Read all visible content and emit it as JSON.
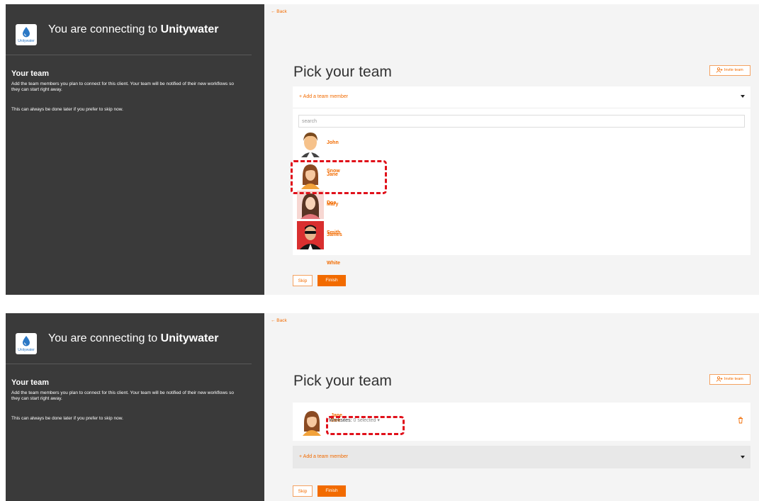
{
  "app": {
    "connecting_prefix": "You are connecting to",
    "client_name": "Unitywater",
    "logo_text": "Unitywater"
  },
  "left_panel": {
    "heading": "Your team",
    "description": "Add the team members you plan to connect for this client. Your team will be notified of their new workflows so they can start right away.",
    "note": "This can always be done later if you prefer to skip now."
  },
  "main": {
    "back_label": "← Back",
    "title": "Pick your team",
    "invite_label": "Invite team",
    "add_member_label": "+ Add a team member",
    "search_placeholder": "search",
    "skip_label": "Skip",
    "finish_label": "Finish"
  },
  "members": [
    {
      "name": "John Snow"
    },
    {
      "name": "Jane Doe"
    },
    {
      "name": "Mary Smith"
    },
    {
      "name": "James White"
    }
  ],
  "selected_member": {
    "name": "Jane Doe",
    "worksites_label": "Worksites:",
    "worksites_value": "0 selected"
  },
  "colors": {
    "accent": "#f26b00",
    "sidebar": "#3a3a3a",
    "highlight": "#e0101a"
  }
}
